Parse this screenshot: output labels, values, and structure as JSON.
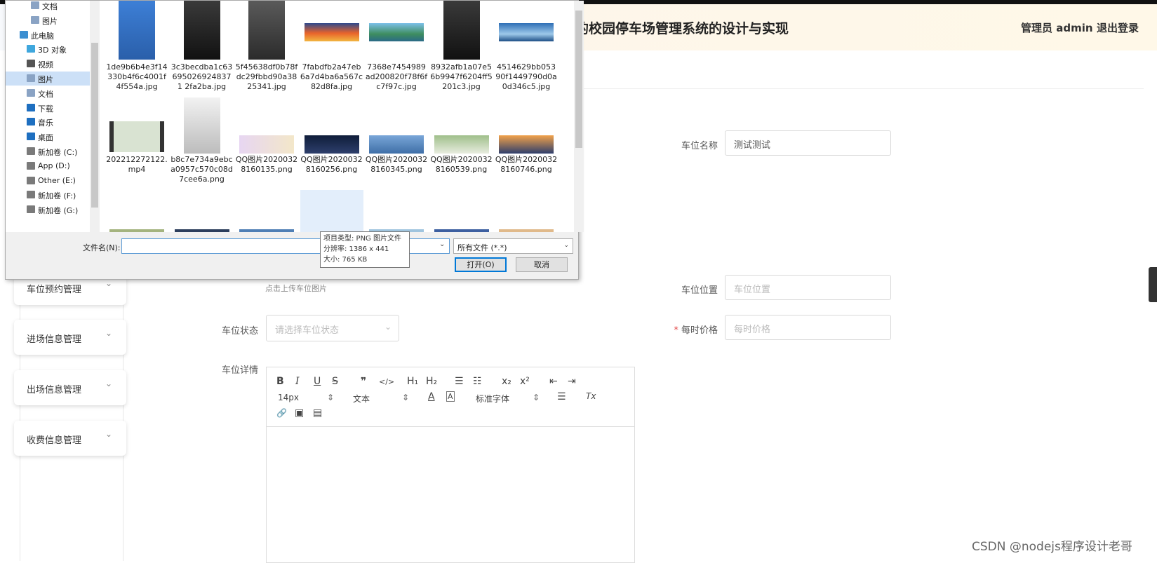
{
  "header": {
    "title": "的校园停车场管理系统的设计与实现",
    "user_label": "管理员 admin",
    "logout_label": "退出登录"
  },
  "menu": [
    {
      "label": "车位预约管理",
      "icon": "chevron-down-icon"
    },
    {
      "label": "进场信息管理",
      "icon": "chevron-down-icon"
    },
    {
      "label": "出场信息管理",
      "icon": "chevron-down-icon"
    },
    {
      "label": "收费信息管理",
      "icon": "chevron-down-icon"
    }
  ],
  "form": {
    "name_label": "车位名称",
    "name_value": "测试测试",
    "upload_hint": "点击上传车位图片",
    "location_label": "车位位置",
    "location_placeholder": "车位位置",
    "status_label": "车位状态",
    "status_placeholder": "请选择车位状态",
    "price_required": "*",
    "price_label": "每时价格",
    "price_placeholder": "每时价格",
    "detail_label": "车位详情"
  },
  "editor_toolbar": {
    "bold": "B",
    "italic": "I",
    "underline": "U",
    "strike": "S",
    "quote": "❞",
    "code": "</>",
    "h1": "H₁",
    "h2": "H₂",
    "ordered_list": "☰",
    "bullet_list": "☷",
    "subscript": "x₂",
    "superscript": "x²",
    "outdent": "⇤",
    "indent": "⇥",
    "size": "14px",
    "format": "文本",
    "font": "标准字体",
    "color": "A",
    "background": "A",
    "align": "☰",
    "clear": "Tx",
    "link": "🔗",
    "image": "▣",
    "video": "▤"
  },
  "watermark": "CSDN @nodejs程序设计老哥",
  "dialog": {
    "nav": [
      {
        "label": "文档",
        "icon": "document-icon",
        "color": "#8aa3c4"
      },
      {
        "label": "图片",
        "icon": "picture-icon",
        "color": "#8aa3c4"
      },
      {
        "label": "此电脑",
        "icon": "computer-icon",
        "color": "#3c8fd1"
      },
      {
        "label": "3D 对象",
        "icon": "cube-icon",
        "color": "#3fa7dd"
      },
      {
        "label": "视频",
        "icon": "video-icon",
        "color": "#555"
      },
      {
        "label": "图片",
        "icon": "picture-icon",
        "color": "#8aa3c4"
      },
      {
        "label": "文档",
        "icon": "document-icon",
        "color": "#8aa3c4"
      },
      {
        "label": "下载",
        "icon": "download-icon",
        "color": "#1e6fc0"
      },
      {
        "label": "音乐",
        "icon": "music-icon",
        "color": "#1e6fc0"
      },
      {
        "label": "桌面",
        "icon": "desktop-icon",
        "color": "#1e6fc0"
      },
      {
        "label": "新加卷 (C:)",
        "icon": "drive-icon",
        "color": "#7a7a7a"
      },
      {
        "label": "App (D:)",
        "icon": "drive-icon",
        "color": "#7a7a7a"
      },
      {
        "label": "Other (E:)",
        "icon": "drive-icon",
        "color": "#7a7a7a"
      },
      {
        "label": "新加卷 (F:)",
        "icon": "drive-icon",
        "color": "#7a7a7a"
      },
      {
        "label": "新加卷 (G:)",
        "icon": "drive-icon",
        "color": "#7a7a7a"
      }
    ],
    "files": [
      {
        "name": "1de9b6b4e3f14330b4f6c4001f4f554a.jpg",
        "kind": "portrait-blue"
      },
      {
        "name": "3c3becdba1c636950269248371 2fa2ba.jpg",
        "kind": "portrait-dark"
      },
      {
        "name": "5f45638df0b78fdc29fbbd90a3825341.jpg",
        "kind": "portrait-grey"
      },
      {
        "name": "7fabdfb2a47eb6a7d4ba6a567c82d8fa.jpg",
        "kind": "sunset"
      },
      {
        "name": "7368e7454989ad200820f78f6fc7f97c.jpg",
        "kind": "lake"
      },
      {
        "name": "8932afb1a07e56b9947f6204ff5201c3.jpg",
        "kind": "portrait-dark"
      },
      {
        "name": "4514629bb05390f1449790d0a0d346c5.jpg",
        "kind": "sky"
      },
      {
        "name": "202212272122.mp4",
        "kind": "video"
      },
      {
        "name": "b8c7e734a9ebca0957c570c08d7cee6a.png",
        "kind": "portrait-white"
      },
      {
        "name": "QQ图片20200328160135.png",
        "kind": "banner-pink"
      },
      {
        "name": "QQ图片20200328160256.png",
        "kind": "night"
      },
      {
        "name": "QQ图片20200328160345.png",
        "kind": "bridge"
      },
      {
        "name": "QQ图片20200328160539.png",
        "kind": "banner-green"
      },
      {
        "name": "QQ图片20200328160746.png",
        "kind": "beach"
      }
    ],
    "filename_label": "文件名(N):",
    "filename_value": "",
    "filetype": "所有文件 (*.*)",
    "open_button": "打开(O)",
    "cancel_button": "取消",
    "tooltip": {
      "type": "项目类型: PNG 图片文件",
      "resolution": "分辨率: 1386 x 441",
      "size": "大小: 765 KB"
    }
  }
}
